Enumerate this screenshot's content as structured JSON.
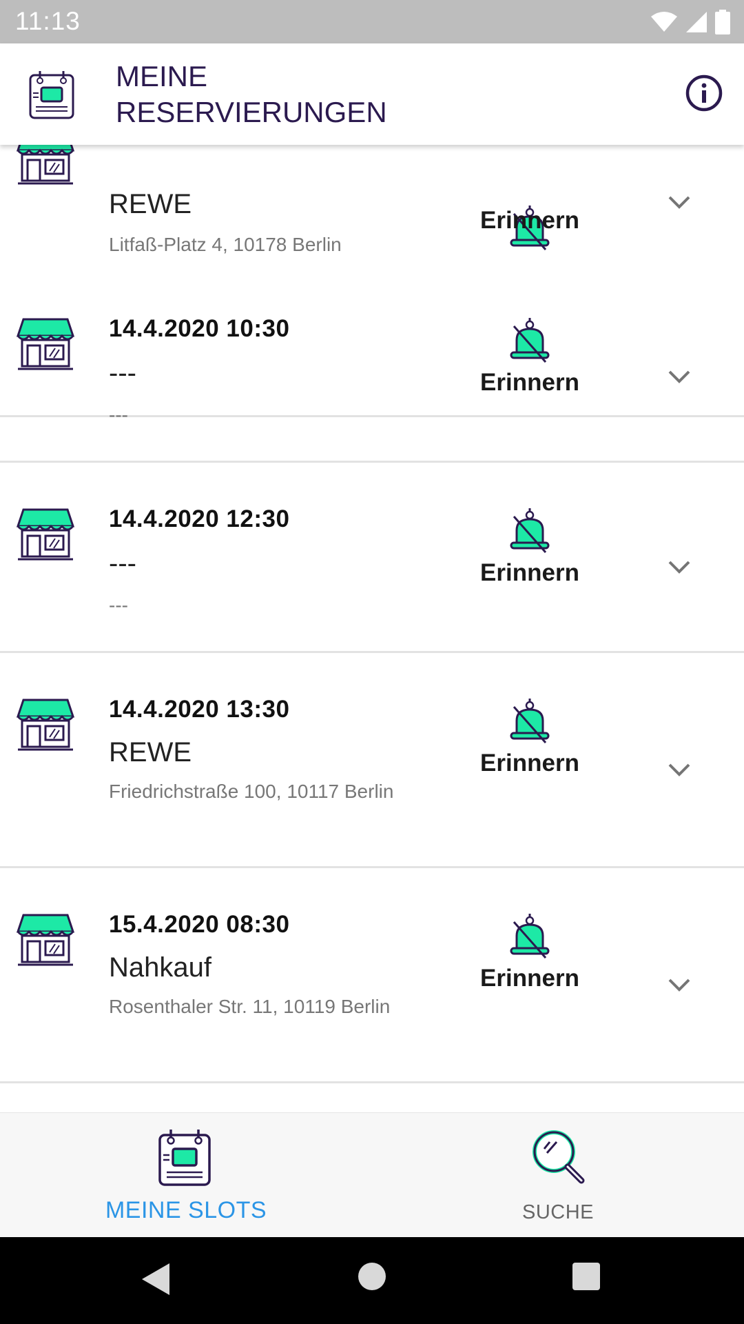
{
  "status_bar": {
    "time": "11:13"
  },
  "header": {
    "title_line1": "MEINE",
    "title_line2": "RESERVIERUNGEN"
  },
  "reservations": [
    {
      "datetime": "",
      "store": "REWE",
      "address": "Litfaß-Platz 4, 10178 Berlin",
      "reminder_label": "Erinnern"
    },
    {
      "datetime": "14.4.2020 10:30",
      "store": "---",
      "address": "---",
      "reminder_label": "Erinnern"
    },
    {
      "datetime": "14.4.2020 12:30",
      "store": "---",
      "address": "---",
      "reminder_label": "Erinnern"
    },
    {
      "datetime": "14.4.2020 13:30",
      "store": "REWE",
      "address": "Friedrichstraße 100, 10117 Berlin",
      "reminder_label": "Erinnern"
    },
    {
      "datetime": "15.4.2020 08:30",
      "store": "Nahkauf",
      "address": "Rosenthaler Str. 11, 10119 Berlin",
      "reminder_label": "Erinnern"
    }
  ],
  "bottom_nav": {
    "slots_label": "MEINE SLOTS",
    "search_label": "SUCHE"
  },
  "colors": {
    "accent_green": "#1de9a6",
    "dark_purple": "#2b1a4f",
    "active_blue": "#2b95e6"
  }
}
